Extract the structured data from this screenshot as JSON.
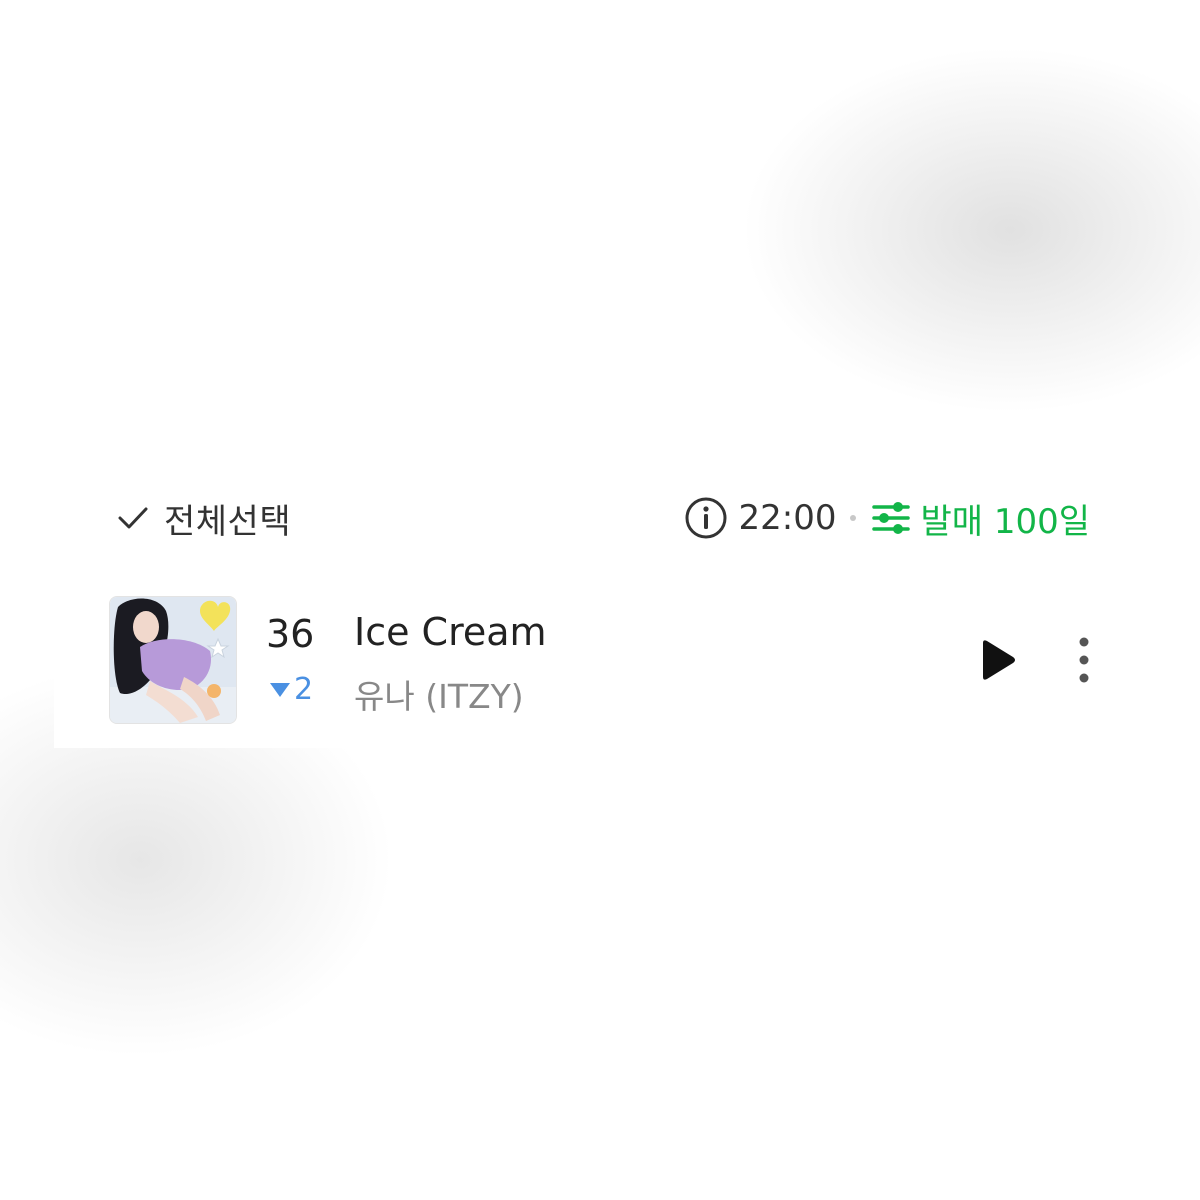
{
  "header": {
    "select_all_label": "전체선택",
    "time": "22:00",
    "filter_label": "발매 100일"
  },
  "track": {
    "rank": "36",
    "rank_change": "2",
    "rank_change_direction": "down",
    "title": "Ice Cream",
    "artist": "유나 (ITZY)"
  },
  "icons": {
    "check": "check-icon",
    "info": "info-icon",
    "filter": "filter-sliders-icon",
    "play": "play-icon",
    "more": "more-vertical-icon",
    "rank_change": "triangle-down-icon"
  },
  "colors": {
    "accent_green": "#12b548",
    "rank_down_blue": "#4a90e2",
    "text_primary": "#222222",
    "text_secondary": "#888888"
  }
}
